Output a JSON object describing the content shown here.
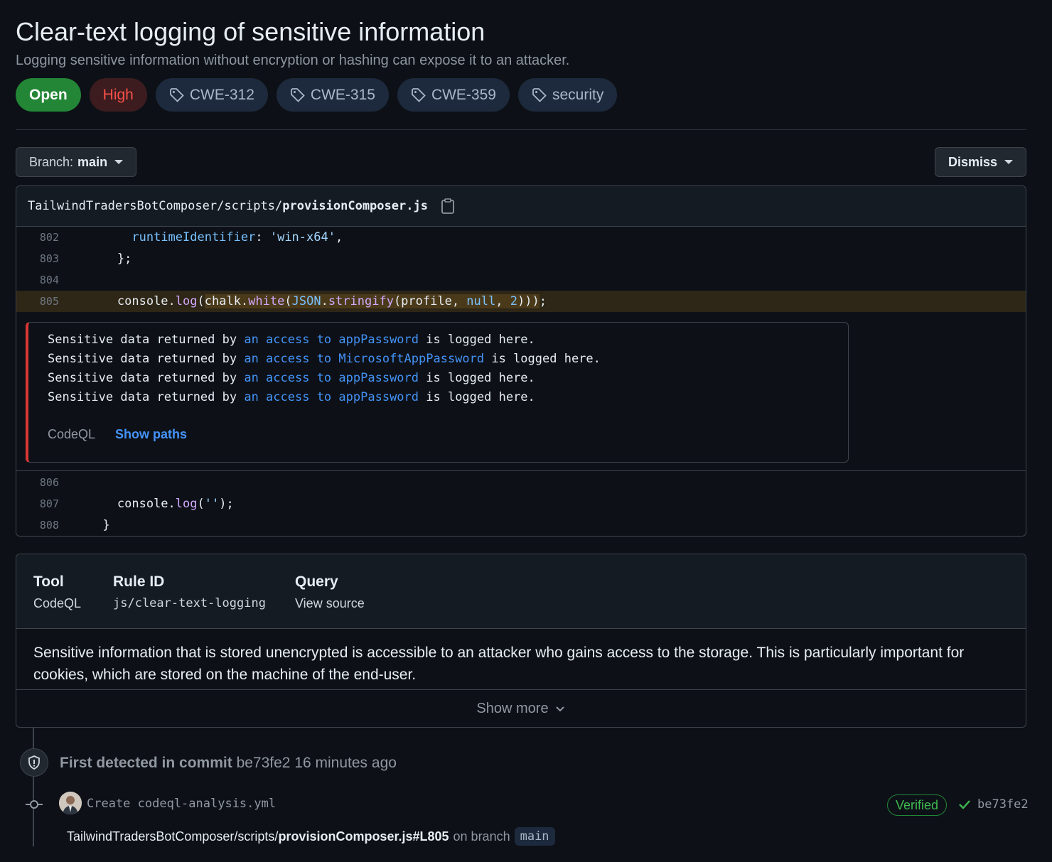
{
  "alert": {
    "title": "Clear-text logging of sensitive information",
    "description": "Logging sensitive information without encryption or hashing can expose it to an attacker.",
    "status": "Open",
    "severity": "High",
    "tags": [
      "CWE-312",
      "CWE-315",
      "CWE-359",
      "security"
    ]
  },
  "toolbar": {
    "branch_label": "Branch:",
    "branch_value": "main",
    "dismiss_label": "Dismiss"
  },
  "file": {
    "path_prefix": "TailwindTradersBotComposer/scripts/",
    "filename": "provisionComposer.js"
  },
  "code": {
    "lines": [
      {
        "num": "802"
      },
      {
        "num": "803",
        "text": "        };"
      },
      {
        "num": "804",
        "text": ""
      },
      {
        "num": "805"
      },
      {
        "num": "806",
        "text": ""
      },
      {
        "num": "807"
      },
      {
        "num": "808",
        "text": "      }"
      }
    ],
    "line802": {
      "indent": "          ",
      "prop": "runtimeIdentifier",
      "colon": ": ",
      "str": "'win-x64'",
      "end": ","
    },
    "line805": {
      "indent": "        ",
      "a": "console.",
      "b": "log",
      "c": "(",
      "d": "chalk.",
      "e": "white",
      "f": "(",
      "g": "JSON",
      "h": ".",
      "i": "stringify",
      "j": "(profile, ",
      "k": "null",
      "l": ", ",
      "m": "2",
      "n": ")))",
      "o": ";"
    },
    "line807": {
      "indent": "        ",
      "a": "console.",
      "b": "log",
      "c": "(",
      "d": "''",
      "e": ");"
    }
  },
  "alert_messages": [
    {
      "pre": "Sensitive data returned by ",
      "link_a": "an access to",
      "link_b": "appPassword",
      "post": " is logged here."
    },
    {
      "pre": "Sensitive data returned by ",
      "link_a": "an access to",
      "link_b": "MicrosoftAppPassword",
      "post": " is logged here."
    },
    {
      "pre": "Sensitive data returned by ",
      "link_a": "an access to",
      "link_b": "appPassword",
      "post": " is logged here."
    },
    {
      "pre": "Sensitive data returned by ",
      "link_a": "an access to",
      "link_b": "appPassword",
      "post": " is logged here."
    }
  ],
  "alert_footer": {
    "tool": "CodeQL",
    "show_paths": "Show paths"
  },
  "info": {
    "tool_label": "Tool",
    "tool_value": "CodeQL",
    "rule_label": "Rule ID",
    "rule_value": "js/clear-text-logging",
    "query_label": "Query",
    "query_value": "View source",
    "description": "Sensitive information that is stored unencrypted is accessible to an attacker who gains access to the storage. This is particularly important for cookies, which are stored on the machine of the end-user.",
    "show_more": "Show more"
  },
  "timeline": {
    "detected_label": "First detected in commit",
    "detected_sha": "be73fe2",
    "detected_time": "16 minutes ago",
    "commit_message": "Create codeql-analysis.yml",
    "verified": "Verified",
    "commit_sha": "be73fe2",
    "path_prefix": "TailwindTradersBotComposer/scripts/",
    "path_file": "provisionComposer.js#L805",
    "on_branch": "on branch",
    "branch": "main"
  },
  "colors": {
    "open": "#238636",
    "high": "#f85149",
    "link": "#4493f8",
    "alert_border": "#da3633",
    "verified": "#3fb950"
  }
}
